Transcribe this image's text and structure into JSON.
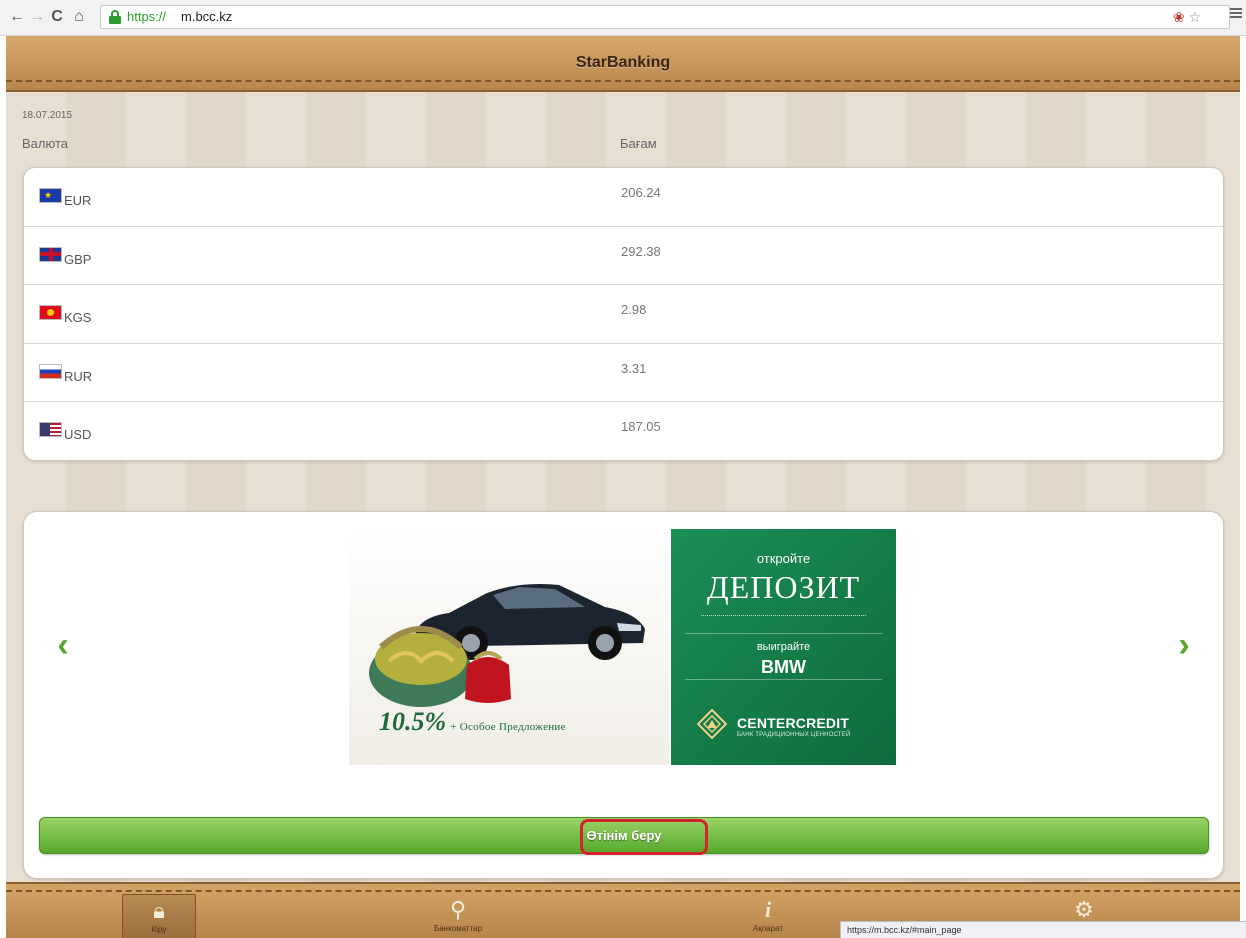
{
  "browser": {
    "url_scheme": "https://",
    "url_host": "m.bcc.kz",
    "status_url": "https://m.bcc.kz/#main_page"
  },
  "header": {
    "title": "StarBanking"
  },
  "rates": {
    "date": "18.07.2015",
    "col_currency": "Валюта",
    "col_rate": "Бағам",
    "rows": [
      {
        "code": "EUR",
        "flag": "eu-flag",
        "rate": "206.24"
      },
      {
        "code": "GBP",
        "flag": "uk-flag",
        "rate": "292.38"
      },
      {
        "code": "KGS",
        "flag": "kg-flag",
        "rate": "2.98"
      },
      {
        "code": "RUR",
        "flag": "ru-flag",
        "rate": "3.31"
      },
      {
        "code": "USD",
        "flag": "us-flag",
        "rate": "187.05"
      }
    ]
  },
  "promo": {
    "prev_icon": "‹",
    "next_icon": "›",
    "banner": {
      "rate": "10.5%",
      "offer": "+ Особое Предложение",
      "open": "откройте",
      "deposit": "ДЕПОЗИТ",
      "win": "выиграйте",
      "prize": "BMW",
      "brand": "CENTERCREDIT",
      "tagline": "БАНК ТРАДИЦИОННЫХ ЦЕННОСТЕЙ"
    },
    "apply_label": "Өтінім беру"
  },
  "nav": {
    "tabs": [
      {
        "icon": "lock-icon",
        "label": "Кіру",
        "active": true
      },
      {
        "icon": "location-pin-icon",
        "label": "Банкоматтар",
        "active": false
      },
      {
        "icon": "info-icon",
        "label": "Ақпарат",
        "active": false
      },
      {
        "icon": "gear-icon",
        "label": "",
        "active": false
      }
    ]
  },
  "colors": {
    "header": "#c39559",
    "accent_green": "#58a531",
    "highlight": "#d4232a",
    "deposit_green": "#16804a"
  }
}
